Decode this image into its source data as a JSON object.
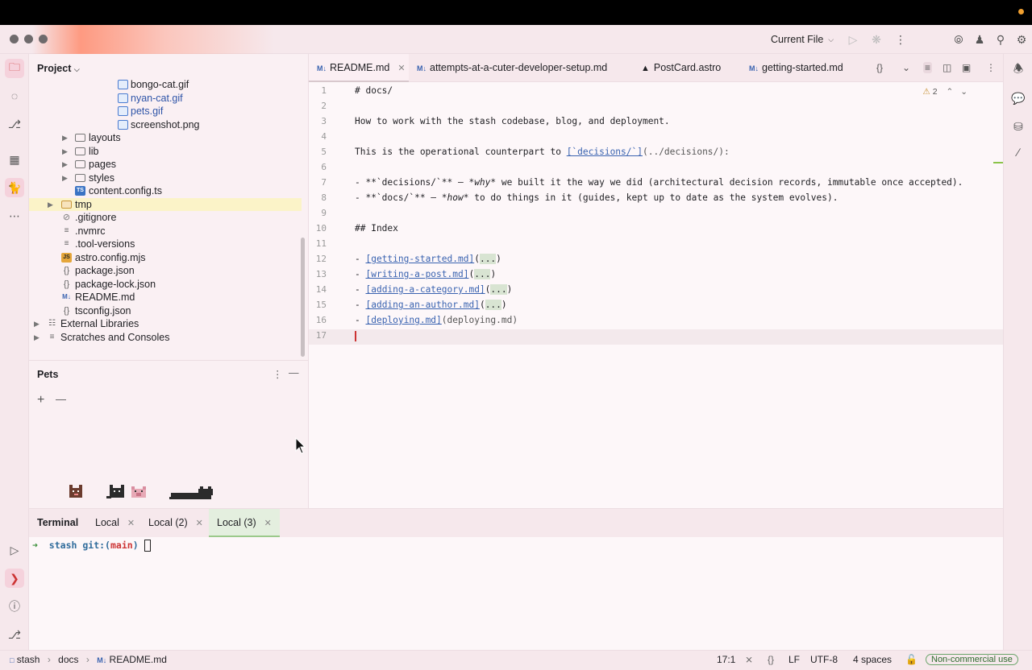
{
  "window": {
    "run_config": "Current File"
  },
  "project": {
    "title": "Project",
    "items": [
      {
        "label": "bongo-cat.gif",
        "kind": "img"
      },
      {
        "label": "nyan-cat.gif",
        "kind": "img"
      },
      {
        "label": "pets.gif",
        "kind": "img"
      },
      {
        "label": "screenshot.png",
        "kind": "img"
      },
      {
        "label": "layouts",
        "kind": "folder"
      },
      {
        "label": "lib",
        "kind": "folder"
      },
      {
        "label": "pages",
        "kind": "folder"
      },
      {
        "label": "styles",
        "kind": "folder"
      },
      {
        "label": "content.config.ts",
        "kind": "ts"
      },
      {
        "label": "tmp",
        "kind": "folder"
      },
      {
        "label": ".gitignore",
        "kind": "blocked"
      },
      {
        "label": ".nvmrc",
        "kind": "lines"
      },
      {
        "label": ".tool-versions",
        "kind": "lines"
      },
      {
        "label": "astro.config.mjs",
        "kind": "js"
      },
      {
        "label": "package.json",
        "kind": "braces"
      },
      {
        "label": "package-lock.json",
        "kind": "braces"
      },
      {
        "label": "README.md",
        "kind": "md"
      },
      {
        "label": "tsconfig.json",
        "kind": "braces"
      },
      {
        "label": "External Libraries",
        "kind": "lib"
      },
      {
        "label": "Scratches and Consoles",
        "kind": "lib"
      }
    ]
  },
  "pets": {
    "title": "Pets",
    "add": "+",
    "remove": "—"
  },
  "tabs": [
    {
      "label": "README.md",
      "active": true
    },
    {
      "label": "attempts-at-a-cuter-developer-setup.md",
      "active": false
    },
    {
      "label": "PostCard.astro",
      "active": false
    },
    {
      "label": "getting-started.md",
      "active": false
    }
  ],
  "editor": {
    "warnings": "2",
    "line_numbers": [
      "1",
      "2",
      "3",
      "4",
      "5",
      "6",
      "7",
      "8",
      "9",
      "10",
      "11",
      "12",
      "13",
      "14",
      "15",
      "16",
      "17"
    ],
    "l1": "# docs/",
    "l3": "How to work with the stash codebase, blog, and deployment.",
    "l5a": "This is the operational counterpart to ",
    "l5link": "[`decisions/`]",
    "l5b": "(../decisions/):",
    "l7a": "- **`decisions/`** — ",
    "l7b": "*why*",
    "l7c": " we built it the way we did (architectural decision records, immutable once accepted).",
    "l8a": "- **`docs/`** — ",
    "l8b": "*how*",
    "l8c": " to do things in it (guides, kept up to date as the system evolves).",
    "l10": "## Index",
    "l12link": "[getting-started.md]",
    "l13link": "[writing-a-post.md]",
    "l14link": "[adding-a-category.md]",
    "l15link": "[adding-an-author.md]",
    "l16link": "[deploying.md]",
    "l16b": "(deploying.md)",
    "list_dash": "- ",
    "paren_open": "(",
    "paren_close": ")",
    "folded": "..."
  },
  "terminal": {
    "title": "Terminal",
    "tabs": [
      "Local",
      "Local (2)",
      "Local (3)"
    ],
    "arrow": "➜",
    "dir": "stash",
    "git": "git:(",
    "branch": "main",
    "git_close": ")"
  },
  "breadcrumb": {
    "root": "stash",
    "folder": "docs",
    "file": "README.md"
  },
  "status": {
    "position": "17:1",
    "line_sep": "LF",
    "encoding": "UTF-8",
    "indent": "4 spaces",
    "license": "Non-commercial use"
  },
  "colors": {
    "accent": "#c33333",
    "link": "#3a63b0",
    "selection": "#fbf3c8"
  }
}
